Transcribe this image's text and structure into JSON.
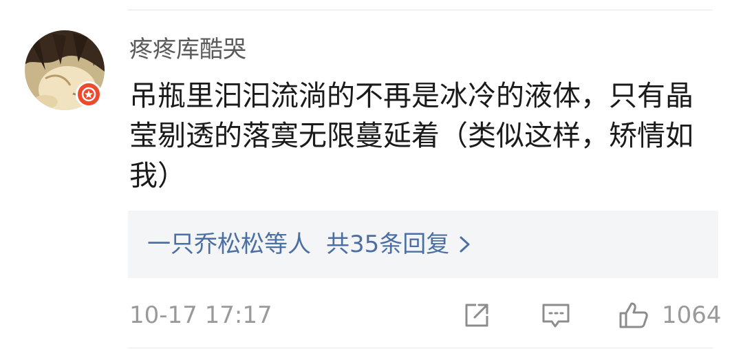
{
  "comment": {
    "username": "疼疼库酷哭",
    "text": "吊瓶里汩汩流淌的不再是冰冷的液体，只有晶莹剔透的落寞无限蔓延着（类似这样，矫情如我）",
    "replies": {
      "users_text": "一只乔松松等人",
      "count_text": "共35条回复"
    },
    "timestamp": "10-17 17:17",
    "like_count": "1064"
  },
  "icons": {
    "avatar": "avatar-image",
    "badge": "verified-badge-icon",
    "chevron": "chevron-right-icon",
    "share": "share-icon",
    "comment": "comment-icon",
    "like": "thumbs-up-icon"
  },
  "colors": {
    "link": "#4b6fa3",
    "badge": "#f04a2c",
    "muted": "#9a9a9a",
    "replies_bg": "#f4f5f7"
  }
}
